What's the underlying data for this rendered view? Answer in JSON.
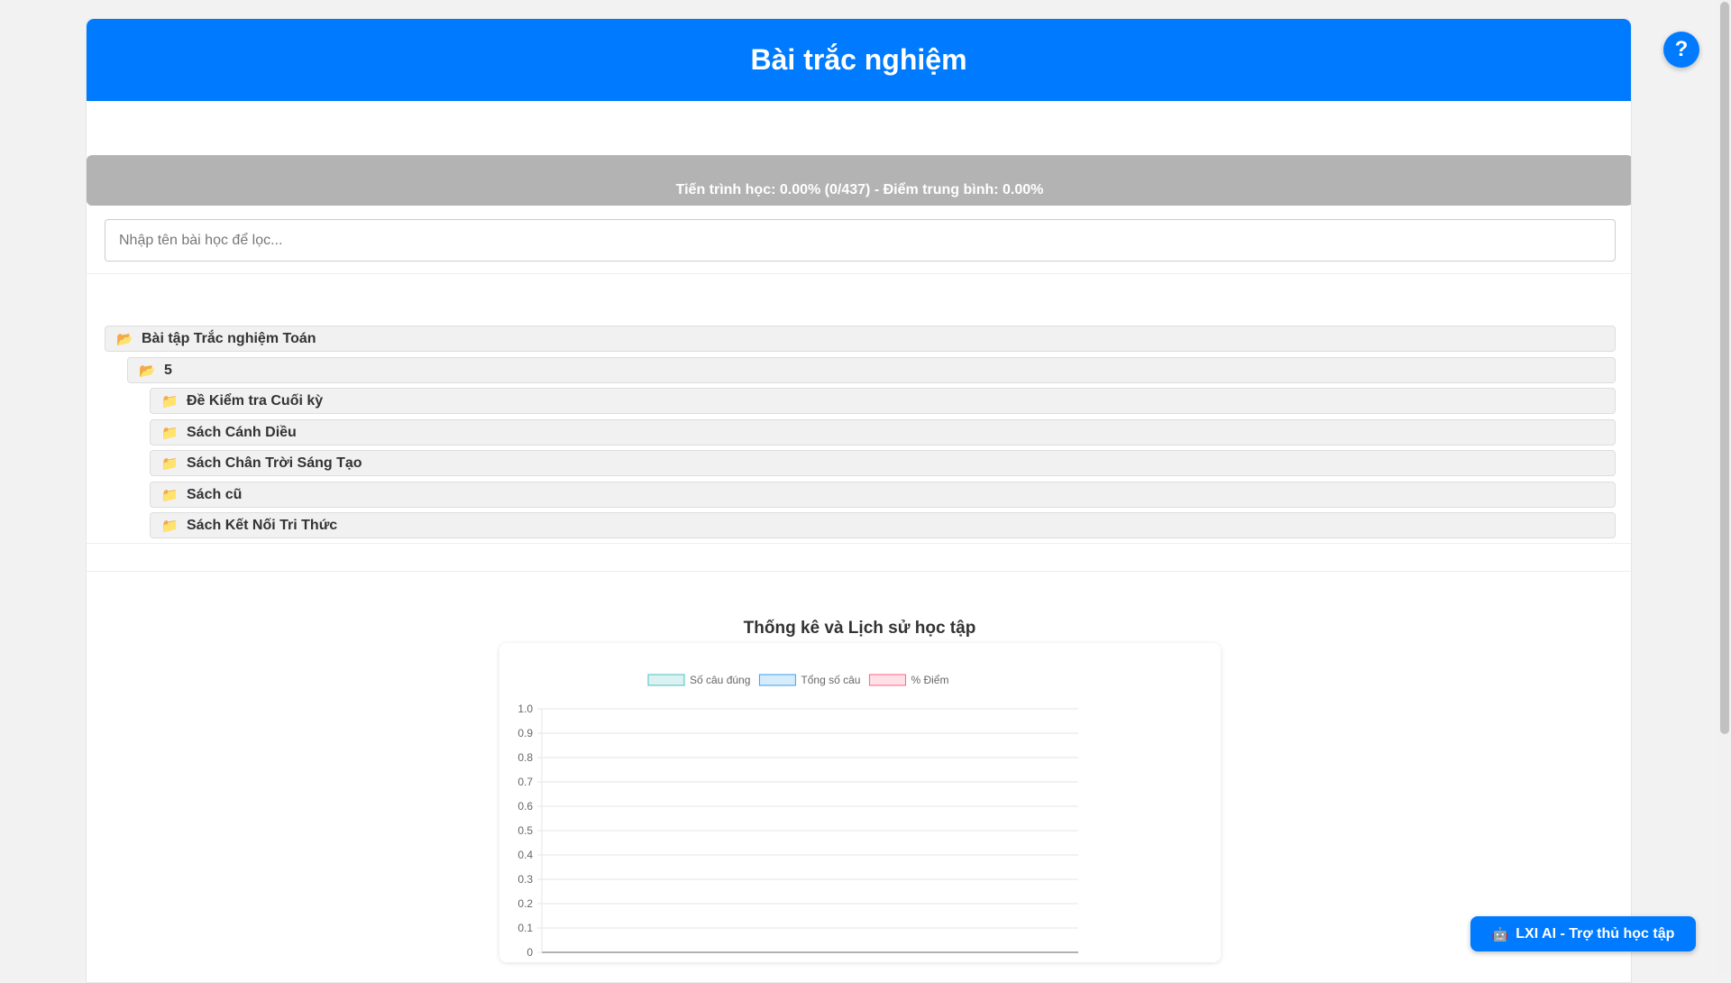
{
  "header": {
    "title": "Bài trắc nghiệm"
  },
  "progress": {
    "text": "Tiến trình học: 0.00% (0/437) - Điểm trung bình: 0.00%",
    "percent": 0
  },
  "search": {
    "placeholder": "Nhập tên bài học để lọc..."
  },
  "tree": {
    "root": {
      "label": "Bài tập Trắc nghiệm Toán",
      "icon": "open-folder-icon"
    },
    "grade": {
      "label": "5",
      "icon": "open-folder-icon"
    },
    "children": [
      {
        "label": "Đề Kiểm tra Cuối kỳ",
        "icon": "folder-icon"
      },
      {
        "label": "Sách Cánh Diều",
        "icon": "folder-icon"
      },
      {
        "label": "Sách Chân Trời Sáng Tạo",
        "icon": "folder-icon"
      },
      {
        "label": "Sách cũ",
        "icon": "folder-icon"
      },
      {
        "label": "Sách Kết Nối Tri Thức",
        "icon": "folder-icon"
      }
    ]
  },
  "stats": {
    "title": "Thống kê và Lịch sử học tập"
  },
  "chart_data": {
    "type": "bar",
    "categories": [],
    "series": [
      {
        "name": "Số câu đúng",
        "values": [],
        "color": "#4bc0c0"
      },
      {
        "name": "Tổng số câu",
        "values": [],
        "color": "#36a2eb"
      },
      {
        "name": "% Điểm",
        "values": [],
        "color": "#ff6384"
      }
    ],
    "ylim": [
      0,
      1.0
    ],
    "yticks": [
      "1.0",
      "0.9",
      "0.8",
      "0.7",
      "0.6",
      "0.5",
      "0.4",
      "0.3",
      "0.2",
      "0.1",
      "0"
    ],
    "grid": true,
    "legend": "top"
  },
  "help_button": {
    "label": "?"
  },
  "ai_button": {
    "label": "LXI AI - Trợ thủ học tập",
    "icon": "robot-icon",
    "glyph": "🤖"
  },
  "colors": {
    "primary": "#007bff",
    "progress_bg": "#b3b3b3"
  }
}
